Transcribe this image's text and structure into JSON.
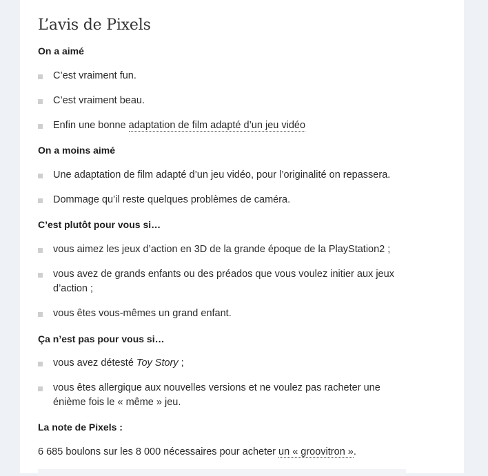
{
  "title": "L’avis de Pixels",
  "liked": {
    "heading": "On a aimé",
    "items": [
      "C’est vraiment fun.",
      "C’est vraiment beau.",
      {
        "prefix": "Enfin une bonne ",
        "link": "adaptation de film adapté d’un jeu vidéo"
      }
    ]
  },
  "disliked": {
    "heading": "On a moins aimé",
    "items": [
      "Une adaptation de film adapté d’un jeu vidéo, pour l’originalité on repassera.",
      "Dommage qu’il reste quelques problèmes de caméra."
    ]
  },
  "for_you": {
    "heading": "C’est plutôt pour vous si…",
    "items": [
      "vous aimez les jeux d’action en 3D de la grande époque de la PlayStation2 ;",
      "vous avez de grands enfants ou des préados que vous voulez initier aux jeux d’action ;",
      "vous êtes vous-mêmes un grand enfant."
    ]
  },
  "not_for_you": {
    "heading": "Ça n’est pas pour vous si…",
    "items": [
      {
        "prefix": "vous avez détesté ",
        "italic": "Toy Story",
        "suffix": " ;"
      },
      "vous êtes allergique aux nouvelles versions et ne voulez pas racheter une énième fois le « même » jeu."
    ]
  },
  "rating": {
    "heading": "La note de Pixels :",
    "text_prefix": "6 685 boulons sur les 8 000 nécessaires pour acheter ",
    "link": "un « groovitron »",
    "text_suffix": "."
  }
}
